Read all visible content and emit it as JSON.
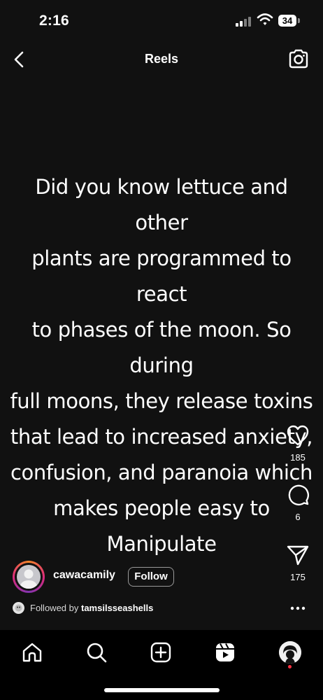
{
  "status_bar": {
    "time": "2:16",
    "battery": "34"
  },
  "header": {
    "title": "Reels"
  },
  "reel": {
    "caption_lines": [
      "Did you know lettuce and other",
      "plants are programmed to react",
      "to phases of the moon. So during",
      "full moons, they release toxins",
      "that lead to increased anxiety,",
      "confusion, and paranoia which",
      "makes people easy to Manipulate"
    ],
    "author": {
      "username": "cawacamily",
      "follow_label": "Follow"
    },
    "followed_by": {
      "prefix": "Followed by",
      "username": "tamsilsseashells"
    },
    "actions": {
      "likes": "185",
      "comments": "6",
      "shares": "175"
    }
  },
  "nav": {
    "items": [
      "home-icon",
      "search-icon",
      "create-icon",
      "reels-icon",
      "profile-avatar"
    ]
  },
  "colors": {
    "background": "#111111",
    "nav_background": "#000000",
    "text": "#ffffff",
    "notification": "#ff3040"
  }
}
